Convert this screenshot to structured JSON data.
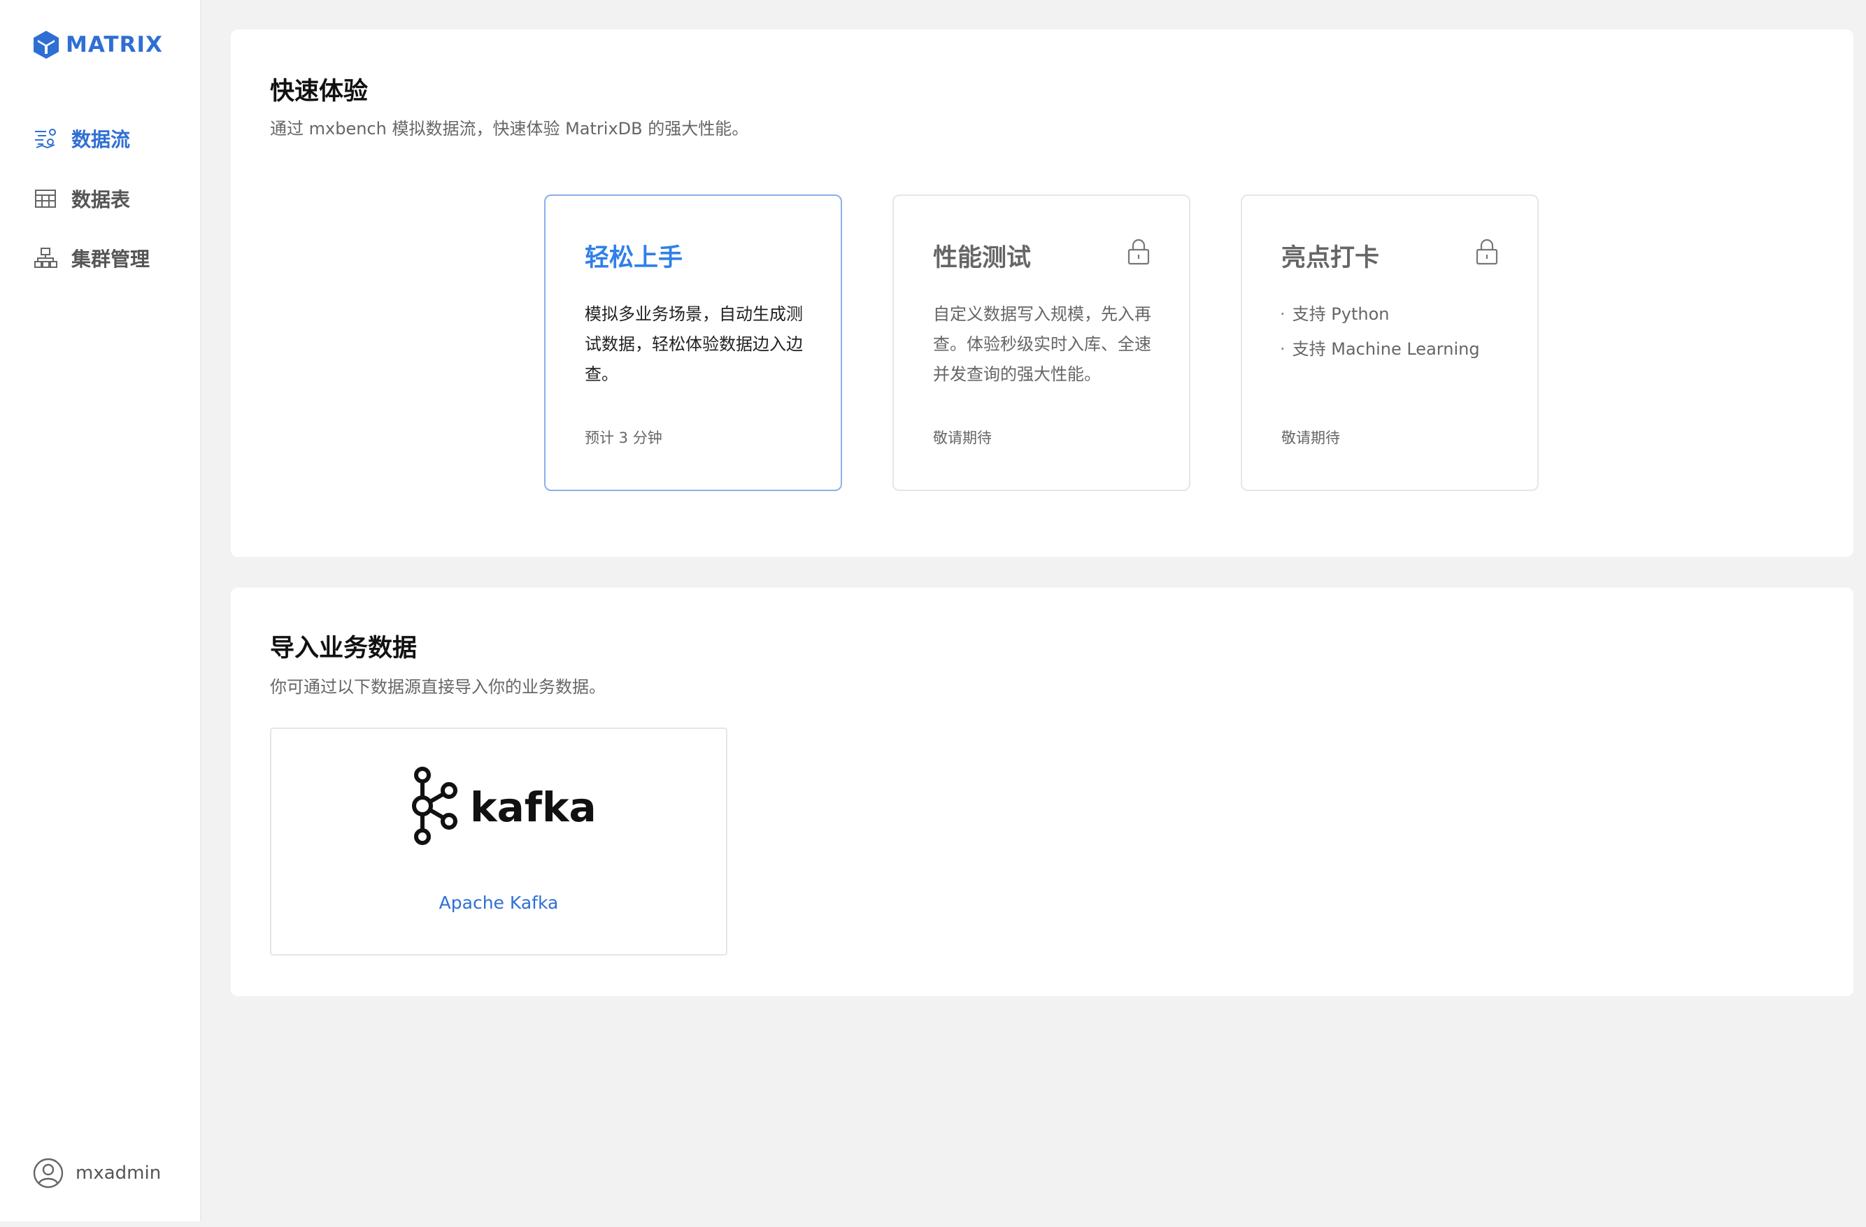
{
  "brand": {
    "name": "MATRIX",
    "color": "#2f6fd4"
  },
  "sidebar": {
    "items": [
      {
        "label": "数据流",
        "icon": "data-stream-icon",
        "active": true
      },
      {
        "label": "数据表",
        "icon": "table-icon",
        "active": false
      },
      {
        "label": "集群管理",
        "icon": "cluster-icon",
        "active": false
      }
    ],
    "user": {
      "name": "mxadmin",
      "icon": "user-avatar-icon"
    }
  },
  "quick_start": {
    "title": "快速体验",
    "description": "通过 mxbench 模拟数据流，快速体验 MatrixDB 的强大性能。",
    "cards": [
      {
        "title": "轻松上手",
        "body": "模拟多业务场景，自动生成测试数据，轻松体验数据边入边查。",
        "footer": "预计 3 分钟",
        "locked": false
      },
      {
        "title": "性能测试",
        "body": "自定义数据写入规模，先入再查。体验秒级实时入库、全速并发查询的强大性能。",
        "footer": "敬请期待",
        "locked": true,
        "lock_icon": "lock-icon"
      },
      {
        "title": "亮点打卡",
        "list": [
          "支持 Python",
          "支持 Machine Learning"
        ],
        "footer": "敬请期待",
        "locked": true,
        "lock_icon": "lock-icon"
      }
    ]
  },
  "import": {
    "title": "导入业务数据",
    "description": "你可通过以下数据源直接导入你的业务数据。",
    "sources": [
      {
        "logo_text": "kafka",
        "label": "Apache Kafka",
        "icon": "kafka-logo"
      }
    ]
  },
  "colors": {
    "accent": "#2f6fd4",
    "card_active_title": "#2f80e8",
    "card_active_border": "#8ab1ec",
    "background": "#f2f2f2"
  }
}
